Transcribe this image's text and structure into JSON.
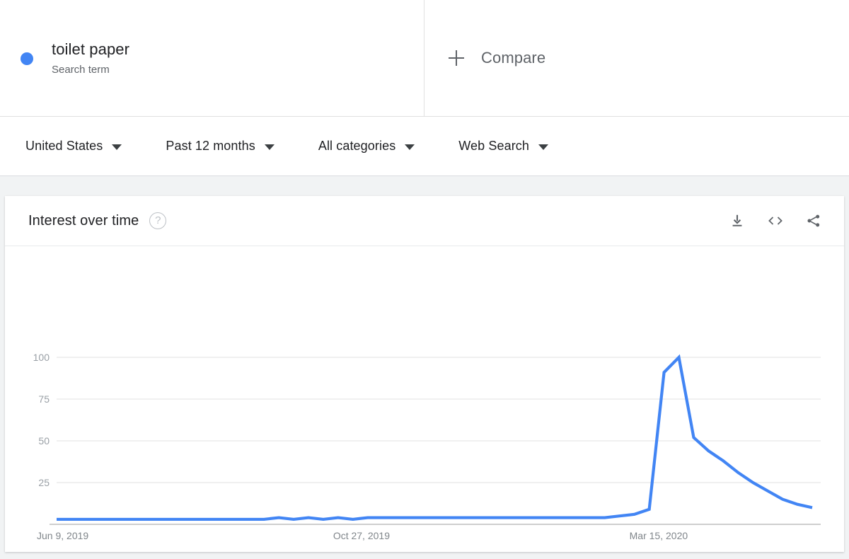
{
  "terms": [
    {
      "name": "toilet paper",
      "type_label": "Search term",
      "color": "#4285f4"
    }
  ],
  "compare": {
    "label": "Compare",
    "icon": "plus-icon"
  },
  "filters": [
    {
      "label": "United States"
    },
    {
      "label": "Past 12 months"
    },
    {
      "label": "All categories"
    },
    {
      "label": "Web Search"
    }
  ],
  "card": {
    "title": "Interest over time",
    "help_icon_glyph": "?",
    "actions": [
      {
        "name": "download-button"
      },
      {
        "name": "embed-button"
      },
      {
        "name": "share-button"
      }
    ]
  },
  "chart_data": {
    "type": "line",
    "title": "Interest over time",
    "xlabel": "",
    "ylabel": "",
    "ylim": [
      0,
      100
    ],
    "yticks": [
      25,
      50,
      75,
      100
    ],
    "grid": true,
    "legend_position": "top",
    "line_color": "#4285f4",
    "xticks": [
      {
        "label": "Jun 9, 2019",
        "index": 0
      },
      {
        "label": "Oct 27, 2019",
        "index": 20
      },
      {
        "label": "Mar 15, 2020",
        "index": 40
      }
    ],
    "series": [
      {
        "name": "toilet paper",
        "color": "#4285f4",
        "x": [
          "Jun 9, 2019",
          "Jun 16, 2019",
          "Jun 23, 2019",
          "Jun 30, 2019",
          "Jul 7, 2019",
          "Jul 14, 2019",
          "Jul 21, 2019",
          "Jul 28, 2019",
          "Aug 4, 2019",
          "Aug 11, 2019",
          "Aug 18, 2019",
          "Aug 25, 2019",
          "Sep 1, 2019",
          "Sep 8, 2019",
          "Sep 15, 2019",
          "Sep 22, 2019",
          "Sep 29, 2019",
          "Oct 6, 2019",
          "Oct 13, 2019",
          "Oct 20, 2019",
          "Oct 27, 2019",
          "Nov 3, 2019",
          "Nov 10, 2019",
          "Nov 17, 2019",
          "Nov 24, 2019",
          "Dec 1, 2019",
          "Dec 8, 2019",
          "Dec 15, 2019",
          "Dec 22, 2019",
          "Dec 29, 2019",
          "Jan 5, 2020",
          "Jan 12, 2020",
          "Jan 19, 2020",
          "Jan 26, 2020",
          "Feb 2, 2020",
          "Feb 9, 2020",
          "Feb 16, 2020",
          "Feb 23, 2020",
          "Mar 1, 2020",
          "Mar 8, 2020",
          "Mar 15, 2020",
          "Mar 22, 2020",
          "Mar 29, 2020",
          "Apr 5, 2020",
          "Apr 12, 2020",
          "Apr 19, 2020",
          "Apr 26, 2020",
          "May 3, 2020",
          "May 10, 2020",
          "May 17, 2020",
          "May 24, 2020",
          "May 31, 2020"
        ],
        "values": [
          3,
          3,
          3,
          3,
          3,
          3,
          3,
          3,
          3,
          3,
          3,
          3,
          3,
          3,
          3,
          4,
          3,
          4,
          3,
          4,
          3,
          4,
          4,
          4,
          4,
          4,
          4,
          4,
          4,
          4,
          4,
          4,
          4,
          4,
          4,
          4,
          4,
          4,
          5,
          6,
          9,
          91,
          100,
          52,
          44,
          38,
          31,
          25,
          20,
          15,
          12,
          10
        ]
      }
    ]
  }
}
